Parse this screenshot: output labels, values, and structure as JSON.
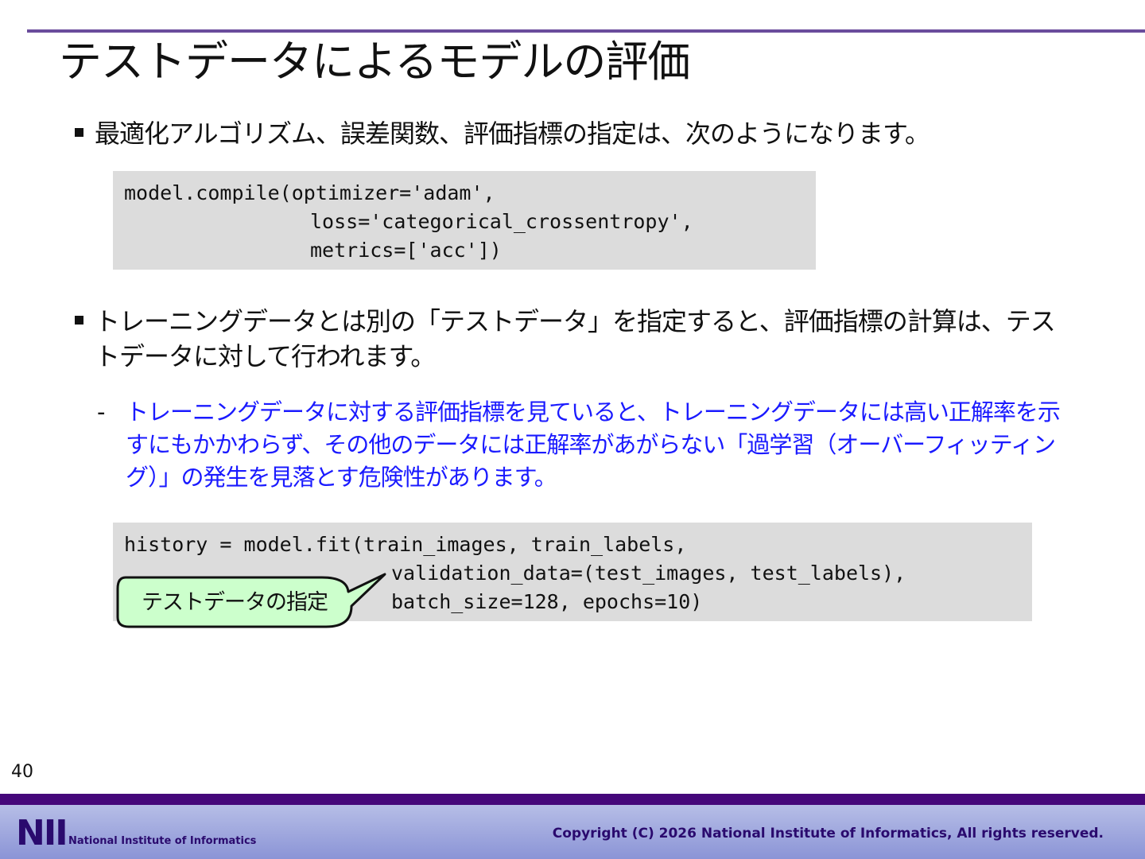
{
  "slide": {
    "title": "テストデータによるモデルの評価",
    "page_number": "40"
  },
  "bullets": [
    {
      "text": "最適化アルゴリズム、誤差関数、評価指標の指定は、次のようになります。"
    },
    {
      "text": "トレーニングデータとは別の「テストデータ」を指定すると、評価指標の計算は、テストデータに対して行われます。"
    }
  ],
  "sub_bullet": {
    "dash": "-",
    "text": "トレーニングデータに対する評価指標を見ていると、トレーニングデータには高い正解率を示すにもかかわらず、その他のデータには正解率があがらない「過学習（オーバーフィッティング）」の発生を見落とす危険性があります。"
  },
  "code_blocks": [
    {
      "lines": [
        "model.compile(optimizer='adam',",
        "loss='categorical_crossentropy',",
        "metrics=['acc'])"
      ]
    },
    {
      "lines": [
        "history = model.fit(train_images, train_labels,",
        "validation_data=(test_images, test_labels),",
        "batch_size=128, epochs=10)"
      ]
    }
  ],
  "callout": {
    "text": "テストデータの指定",
    "fill_color": "#ccffcc",
    "border_color": "#111111"
  },
  "footer": {
    "logo_text": "NII",
    "org_name": "National Institute of Informatics",
    "copyright": "Copyright (C) 2026 National Institute of Informatics, All rights reserved."
  },
  "colors": {
    "accent": "#6a4c9c",
    "footer_top": "#45077a",
    "sub_bullet_text": "#1a1aff",
    "code_background": "#dcdcdc"
  }
}
